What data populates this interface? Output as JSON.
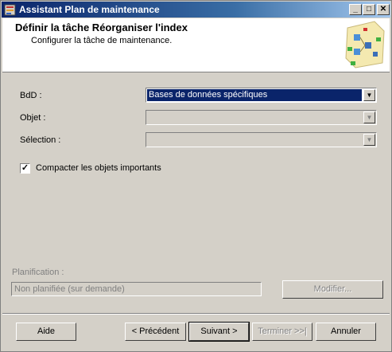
{
  "window": {
    "title": "Assistant Plan de maintenance",
    "controls": {
      "minimize": "_",
      "maximize": "□",
      "close": "✕"
    }
  },
  "header": {
    "title": "Définir la tâche Réorganiser l'index",
    "subtitle": "Configurer la tâche de maintenance."
  },
  "form": {
    "database": {
      "label": "BdD :",
      "value": "Bases de données spécifiques"
    },
    "object": {
      "label": "Objet :",
      "value": ""
    },
    "selection": {
      "label": "Sélection :",
      "value": ""
    },
    "compact": {
      "label": "Compacter les objets importants",
      "checked": true,
      "mark": "✓"
    }
  },
  "schedule": {
    "label": "Planification :",
    "value": "Non planifiée (sur demande)",
    "modify_label": "Modifier..."
  },
  "footer": {
    "help_label": "Aide",
    "previous_label": "< Précédent",
    "next_label": "Suivant >",
    "finish_label": "Terminer >>|",
    "cancel_label": "Annuler"
  }
}
